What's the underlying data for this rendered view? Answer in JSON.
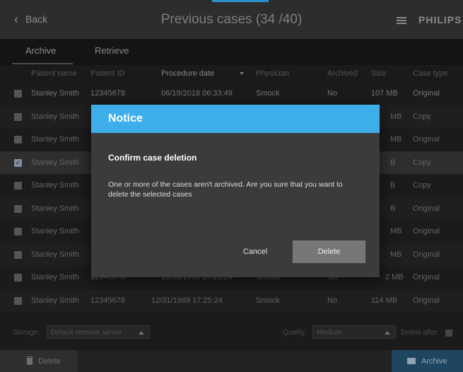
{
  "header": {
    "back_label": "Back",
    "title": "Previous cases (34 /40)",
    "menu_icon": "hamburger-menu-icon",
    "brand": "PHILIPS"
  },
  "tabs": [
    {
      "label": "Archive",
      "active": true
    },
    {
      "label": "Retrieve",
      "active": false
    }
  ],
  "table": {
    "columns": [
      "Patient name",
      "Patient ID",
      "Procedure date",
      "Physician",
      "Archived",
      "Size",
      "Case type"
    ],
    "sorted_column": "Procedure date",
    "rows": [
      {
        "name": "Stanley Smith",
        "id": "12345678",
        "date": "06/19/2018 06:33:49",
        "physician": "Smock",
        "archived": "No",
        "size": "107 MB",
        "type": "Original",
        "checked": false
      },
      {
        "name": "Stanley Smith",
        "id": "",
        "date": "",
        "physician": "",
        "archived": "",
        "size": "MB",
        "type": "Copy",
        "checked": false
      },
      {
        "name": "Stanley Smith",
        "id": "",
        "date": "",
        "physician": "",
        "archived": "",
        "size": "MB",
        "type": "Original",
        "checked": false
      },
      {
        "name": "Stanley Smith",
        "id": "",
        "date": "",
        "physician": "",
        "archived": "",
        "size": "B",
        "type": "Copy",
        "checked": true
      },
      {
        "name": "Stanley Smith",
        "id": "",
        "date": "",
        "physician": "",
        "archived": "",
        "size": "B",
        "type": "Copy",
        "checked": false
      },
      {
        "name": "Stanley Smith",
        "id": "",
        "date": "",
        "physician": "",
        "archived": "",
        "size": "B",
        "type": "Original",
        "checked": false
      },
      {
        "name": "Stanley Smith",
        "id": "",
        "date": "",
        "physician": "",
        "archived": "",
        "size": "MB",
        "type": "Original",
        "checked": false
      },
      {
        "name": "Stanley Smith",
        "id": "",
        "date": "",
        "physician": "",
        "archived": "",
        "size": "MB",
        "type": "Original",
        "checked": false
      },
      {
        "name": "Stanley Smith",
        "id": "12345678",
        "date": "12/31/1969 17:25:24",
        "physician": "Smock",
        "archived": "No",
        "size": "2 MB",
        "type": "Original",
        "checked": false
      },
      {
        "name": "Stanley Smith",
        "id": "12345678",
        "date": "12/31/1969 17:25:24",
        "physician": "Smock",
        "archived": "No",
        "size": "114 MB",
        "type": "Original",
        "checked": false
      }
    ]
  },
  "storage": {
    "label": "Storage:",
    "value": "Default network server",
    "quality_label": "Quality",
    "quality_value": "Medium",
    "extra_label": "Delete after"
  },
  "footer": {
    "delete_label": "Delete",
    "archive_label": "Archive"
  },
  "modal": {
    "title": "Notice",
    "heading": "Confirm case deletion",
    "message": "One or more of the cases aren't archived. Are you sure that you want to delete the selected cases",
    "cancel_label": "Cancel",
    "confirm_label": "Delete"
  },
  "colors": {
    "accent": "#3daee9",
    "archive_button": "#1f4660"
  }
}
